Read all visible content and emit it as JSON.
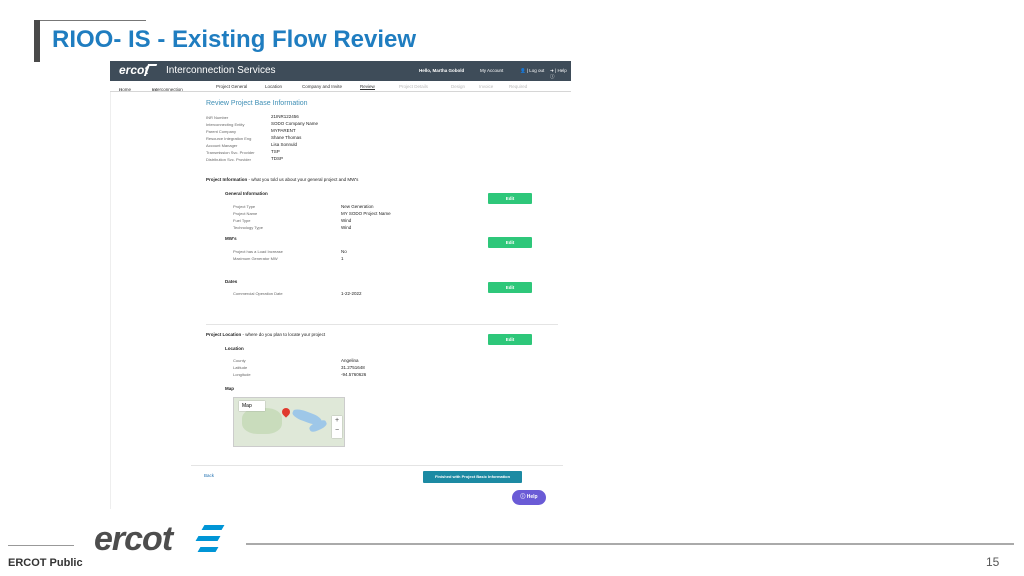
{
  "slide": {
    "title": "RIOO- IS  - Existing Flow Review",
    "footer_label": "ERCOT Public",
    "footer_logo": "ercot",
    "page_number": "15"
  },
  "app": {
    "logo_text": "ercot",
    "name": "Interconnection Services",
    "greeting": "Hello, Martha Gobold",
    "my_account": "My Account",
    "logout": "Log out",
    "help": "Help"
  },
  "nav": {
    "home": "Home",
    "interconnection": "Interconnection",
    "tabs": [
      "Project General",
      "Location",
      "Company and Invite",
      "Review",
      "Project Details",
      "Design",
      "Invoice",
      "Required"
    ],
    "active_tab": "Review"
  },
  "review": {
    "heading": "Review Project Base Information",
    "base_fields": [
      {
        "label": "INR Number",
        "value": "21INR122456"
      },
      {
        "label": "Interconnecting Entity",
        "value": "SODO Company Name"
      },
      {
        "label": "Parent Company",
        "value": "MYPARENT"
      },
      {
        "label": "Resource Integration Eng",
        "value": "Shane Thomas"
      },
      {
        "label": "Account Manager",
        "value": "Lisa Sonnuld"
      },
      {
        "label": "Transmission Svc. Provider",
        "value": "TSP"
      },
      {
        "label": "Distribution Svc. Provider",
        "value": "TDSP"
      }
    ],
    "project_info_title": "Project Information",
    "project_info_desc": " - what you told us about your general project and MW's",
    "general_info": {
      "heading": "General Information",
      "edit_label": "Edit",
      "fields": [
        {
          "label": "Project Type",
          "value": "New Generation"
        },
        {
          "label": "Project Name",
          "value": "MY SODO Project Name"
        },
        {
          "label": "Fuel Type",
          "value": "Wind"
        },
        {
          "label": "Technology Type",
          "value": "Wind"
        }
      ]
    },
    "mws": {
      "heading": "MW's",
      "edit_label": "Edit",
      "fields": [
        {
          "label": "Project has a Load Increase",
          "value": "No"
        },
        {
          "label": "Maximum Generator MW",
          "value": "1"
        }
      ]
    },
    "dates": {
      "heading": "Dates",
      "edit_label": "Edit",
      "fields": [
        {
          "label": "Commercial Operation Date",
          "value": "1-22-2022"
        }
      ]
    },
    "location_title": "Project Location",
    "location_desc": " - where do you plan to locate your project",
    "location": {
      "heading": "Location",
      "edit_label": "Edit",
      "fields": [
        {
          "label": "County",
          "value": "Angelina"
        },
        {
          "label": "Latitude",
          "value": "31.2751648"
        },
        {
          "label": "Longitude",
          "value": "-94.5760626"
        }
      ]
    },
    "map_heading": "Map",
    "map_label": "Map",
    "back_label": "Back",
    "finish_label": "Finished with Project Basic Information",
    "help_button": "Help"
  },
  "colors": {
    "title_blue": "#1f7dc0",
    "edit_green": "#2ec77a",
    "finish_teal": "#1c8aa3",
    "help_purple": "#6a5bd6",
    "topbar": "#3e4c59"
  }
}
